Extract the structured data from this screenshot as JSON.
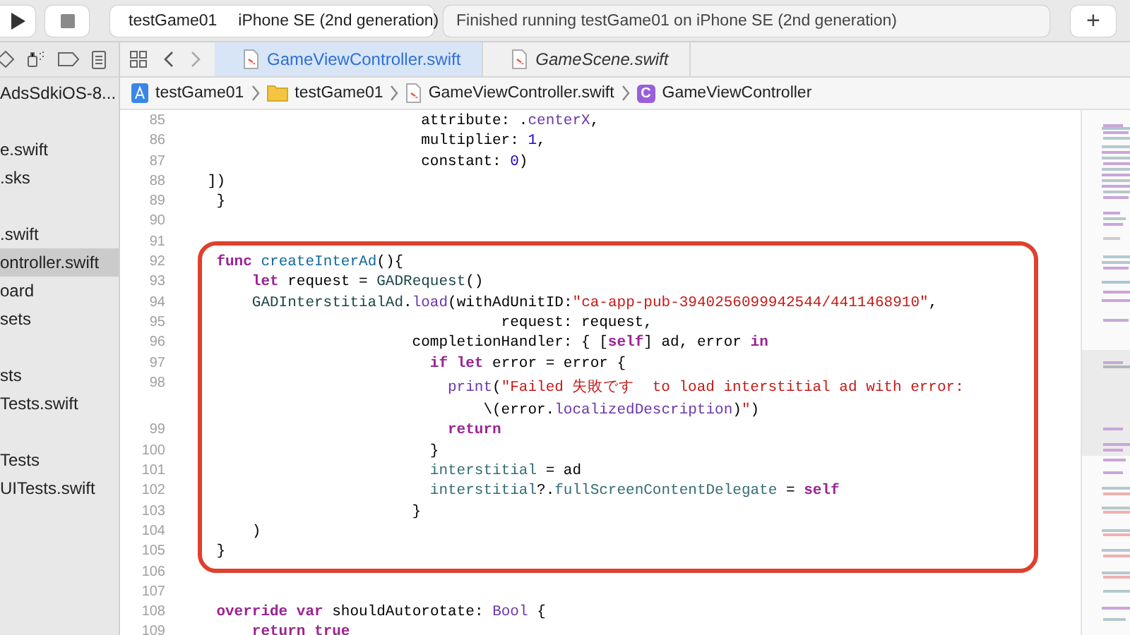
{
  "toolbar": {
    "scheme": "testGame01",
    "destination": "iPhone SE (2nd generation)",
    "status": "Finished running testGame01 on iPhone SE (2nd generation)",
    "add_button": "+"
  },
  "navigator": {
    "groups": [
      [
        {
          "label": "AdsSdkiOS-8...",
          "selected": false
        }
      ],
      [
        {
          "label": "e.swift",
          "selected": false
        },
        {
          "label": ".sks",
          "selected": false
        }
      ],
      [
        {
          "label": ".swift",
          "selected": false
        },
        {
          "label": "ontroller.swift",
          "selected": true
        },
        {
          "label": "oard",
          "selected": false
        },
        {
          "label": "sets",
          "selected": false
        }
      ],
      [
        {
          "label": "sts",
          "selected": false
        },
        {
          "label": "Tests.swift",
          "selected": false
        }
      ],
      [
        {
          "label": "Tests",
          "selected": false
        },
        {
          "label": "UITests.swift",
          "selected": false
        }
      ]
    ]
  },
  "tabs": [
    {
      "label": "GameViewController.swift",
      "selected": true,
      "preview": false
    },
    {
      "label": "GameScene.swift",
      "selected": false,
      "preview": true
    }
  ],
  "breadcrumb": [
    {
      "kind": "project",
      "label": "testGame01"
    },
    {
      "kind": "folder",
      "label": "testGame01"
    },
    {
      "kind": "swift",
      "label": "GameViewController.swift"
    },
    {
      "kind": "class",
      "badge": "C",
      "label": "GameViewController"
    }
  ],
  "editor": {
    "lines": [
      {
        "number": "85",
        "boxed": false,
        "rows": [
          [
            {
              "kind": "plain",
              "text": "                           attribute: ."
            },
            {
              "kind": "method",
              "text": "centerX"
            },
            {
              "kind": "plain",
              "text": ","
            }
          ]
        ]
      },
      {
        "number": "86",
        "boxed": false,
        "rows": [
          [
            {
              "kind": "plain",
              "text": "                           multiplier: "
            },
            {
              "kind": "num",
              "text": "1"
            },
            {
              "kind": "plain",
              "text": ","
            }
          ]
        ]
      },
      {
        "number": "87",
        "boxed": false,
        "rows": [
          [
            {
              "kind": "plain",
              "text": "                           constant: "
            },
            {
              "kind": "num",
              "text": "0"
            },
            {
              "kind": "plain",
              "text": ")"
            }
          ]
        ]
      },
      {
        "number": "88",
        "boxed": false,
        "rows": [
          [
            {
              "kind": "plain",
              "text": "   ])"
            }
          ]
        ]
      },
      {
        "number": "89",
        "boxed": false,
        "rows": [
          [
            {
              "kind": "plain",
              "text": "    }"
            }
          ]
        ]
      },
      {
        "number": "90",
        "boxed": false,
        "rows": [
          []
        ]
      },
      {
        "number": "91",
        "boxed": false,
        "rows": [
          []
        ]
      },
      {
        "number": "92",
        "boxed": true,
        "rows": [
          [
            {
              "kind": "kw",
              "text": "    func"
            },
            {
              "kind": "plain",
              "text": " "
            },
            {
              "kind": "decl",
              "text": "createInterAd"
            },
            {
              "kind": "plain",
              "text": "(){"
            }
          ]
        ]
      },
      {
        "number": "93",
        "boxed": true,
        "rows": [
          [
            {
              "kind": "kw",
              "text": "        let"
            },
            {
              "kind": "plain",
              "text": " request = "
            },
            {
              "kind": "type",
              "text": "GADRequest"
            },
            {
              "kind": "plain",
              "text": "()"
            }
          ]
        ]
      },
      {
        "number": "94",
        "boxed": true,
        "rows": [
          [
            {
              "kind": "type",
              "text": "        GADInterstitialAd"
            },
            {
              "kind": "plain",
              "text": "."
            },
            {
              "kind": "method",
              "text": "load"
            },
            {
              "kind": "plain",
              "text": "(withAdUnitID:"
            },
            {
              "kind": "str",
              "text": "\"ca-app-pub-3940256099942544/4411468910\""
            },
            {
              "kind": "plain",
              "text": ","
            }
          ]
        ]
      },
      {
        "number": "95",
        "boxed": true,
        "rows": [
          [
            {
              "kind": "plain",
              "text": "                                    request: request,"
            }
          ]
        ]
      },
      {
        "number": "96",
        "boxed": true,
        "rows": [
          [
            {
              "kind": "plain",
              "text": "                          completionHandler: { ["
            },
            {
              "kind": "kw",
              "text": "self"
            },
            {
              "kind": "plain",
              "text": "] ad, error "
            },
            {
              "kind": "kw",
              "text": "in"
            }
          ]
        ]
      },
      {
        "number": "97",
        "boxed": true,
        "rows": [
          [
            {
              "kind": "kw",
              "text": "                            if"
            },
            {
              "kind": "plain",
              "text": " "
            },
            {
              "kind": "kw",
              "text": "let"
            },
            {
              "kind": "plain",
              "text": " error = error {"
            }
          ]
        ]
      },
      {
        "number": "98",
        "boxed": true,
        "rows": [
          [
            {
              "kind": "method",
              "text": "                              print"
            },
            {
              "kind": "plain",
              "text": "("
            },
            {
              "kind": "str",
              "text": "\"Failed 失敗です  to load interstitial ad with error:"
            }
          ]
        ],
        "continuation": [
          {
            "kind": "plain",
            "text": "                                  \\(error."
          },
          {
            "kind": "method",
            "text": "localizedDescription"
          },
          {
            "kind": "plain",
            "text": ")"
          },
          {
            "kind": "str",
            "text": "\""
          },
          {
            "kind": "plain",
            "text": ")"
          }
        ]
      },
      {
        "number": "99",
        "boxed": true,
        "rows": [
          [
            {
              "kind": "kw",
              "text": "                              return"
            }
          ]
        ]
      },
      {
        "number": "100",
        "boxed": true,
        "rows": [
          [
            {
              "kind": "plain",
              "text": "                            }"
            }
          ]
        ]
      },
      {
        "number": "101",
        "boxed": true,
        "rows": [
          [
            {
              "kind": "prop",
              "text": "                            interstitial"
            },
            {
              "kind": "plain",
              "text": " = ad"
            }
          ]
        ]
      },
      {
        "number": "102",
        "boxed": true,
        "rows": [
          [
            {
              "kind": "prop",
              "text": "                            interstitial"
            },
            {
              "kind": "plain",
              "text": "?."
            },
            {
              "kind": "prop",
              "text": "fullScreenContentDelegate"
            },
            {
              "kind": "plain",
              "text": " = "
            },
            {
              "kind": "kw",
              "text": "self"
            }
          ]
        ]
      },
      {
        "number": "103",
        "boxed": true,
        "rows": [
          [
            {
              "kind": "plain",
              "text": "                          }"
            }
          ]
        ]
      },
      {
        "number": "104",
        "boxed": true,
        "rows": [
          [
            {
              "kind": "plain",
              "text": "        )"
            }
          ]
        ]
      },
      {
        "number": "105",
        "boxed": true,
        "rows": [
          [
            {
              "kind": "plain",
              "text": "    }"
            }
          ]
        ]
      },
      {
        "number": "106",
        "boxed": false,
        "rows": [
          []
        ]
      },
      {
        "number": "107",
        "boxed": false,
        "rows": [
          []
        ]
      },
      {
        "number": "108",
        "boxed": false,
        "rows": [
          [
            {
              "kind": "kw",
              "text": "    override"
            },
            {
              "kind": "plain",
              "text": " "
            },
            {
              "kind": "kw",
              "text": "var"
            },
            {
              "kind": "plain",
              "text": " shouldAutorotate: "
            },
            {
              "kind": "type2",
              "text": "Bool"
            },
            {
              "kind": "plain",
              "text": " {"
            }
          ]
        ]
      },
      {
        "number": "109",
        "boxed": false,
        "rows": [
          [
            {
              "kind": "kw",
              "text": "        return"
            },
            {
              "kind": "plain",
              "text": " "
            },
            {
              "kind": "kw",
              "text": "true"
            }
          ]
        ]
      }
    ]
  }
}
